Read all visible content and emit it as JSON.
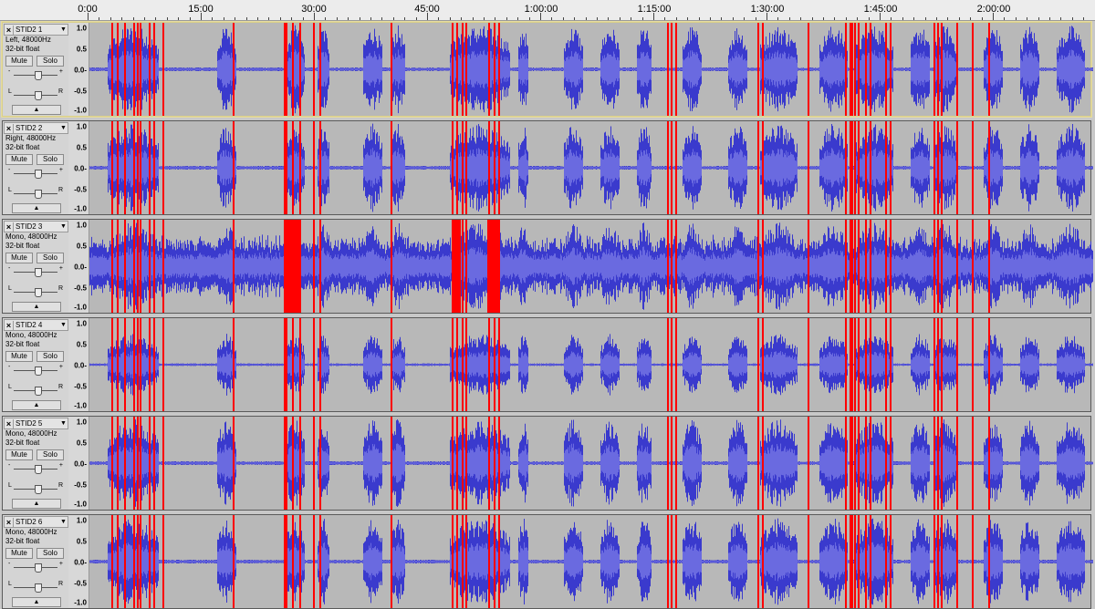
{
  "ruler": {
    "labels": [
      "0:00",
      "15:00",
      "30:00",
      "45:00",
      "1:00:00",
      "1:15:00",
      "1:30:00",
      "1:45:00",
      "2:00:00"
    ]
  },
  "track_template": {
    "close_glyph": "×",
    "menu_glyph": "▼",
    "mute_label": "Mute",
    "solo_label": "Solo",
    "gain_min": "-",
    "gain_max": "+",
    "pan_left": "L",
    "pan_right": "R",
    "collapse_glyph": "▲",
    "scale_labels": [
      "1.0",
      "0.5",
      "0.0-",
      "-0.5",
      "-1.0"
    ]
  },
  "tracks": [
    {
      "name": "STID2 1",
      "channel": "Left, 48000Hz",
      "format": "32-bit float",
      "selected": true,
      "style": "dense"
    },
    {
      "name": "STID2 2",
      "channel": "Right, 48000Hz",
      "format": "32-bit float",
      "selected": false,
      "style": "dense"
    },
    {
      "name": "STID2 3",
      "channel": "Mono, 48000Hz",
      "format": "32-bit float",
      "selected": false,
      "style": "full"
    },
    {
      "name": "STID2 4",
      "channel": "Mono, 48000Hz",
      "format": "32-bit float",
      "selected": false,
      "style": "sparse"
    },
    {
      "name": "STID2 5",
      "channel": "Mono, 48000Hz",
      "format": "32-bit float",
      "selected": false,
      "style": "dense"
    },
    {
      "name": "STID2 6",
      "channel": "Mono, 48000Hz",
      "format": "32-bit float",
      "selected": false,
      "style": "dense"
    }
  ],
  "colors": {
    "wave_blue": "#3a3acd",
    "wave_light": "#6a6ae0",
    "clip_red": "#ff0000",
    "track_bg": "#b8b8b8"
  }
}
